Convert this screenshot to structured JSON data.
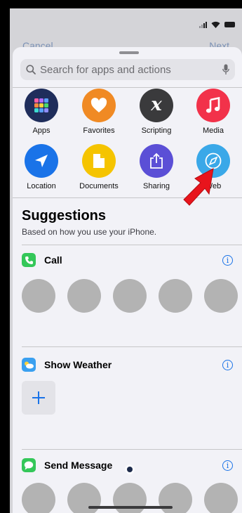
{
  "background": {
    "left_link": "Cancel",
    "right_link": "Next"
  },
  "search": {
    "placeholder": "Search for apps and actions"
  },
  "categories": [
    {
      "label": "Apps",
      "icon": "apps-grid-icon",
      "color": "#1f2d5b"
    },
    {
      "label": "Favorites",
      "icon": "heart-icon",
      "color": "#f08a24"
    },
    {
      "label": "Scripting",
      "icon": "scripting-x-icon",
      "color": "#3a3a3c"
    },
    {
      "label": "Media",
      "icon": "music-note-icon",
      "color": "#f2324a"
    },
    {
      "label": "Location",
      "icon": "location-arrow-icon",
      "color": "#1a73e8"
    },
    {
      "label": "Documents",
      "icon": "document-icon",
      "color": "#f5c400"
    },
    {
      "label": "Sharing",
      "icon": "share-icon",
      "color": "#5b4fd6"
    },
    {
      "label": "Web",
      "icon": "compass-icon",
      "color": "#3aa8e8"
    }
  ],
  "suggestions": {
    "title": "Suggestions",
    "subtitle": "Based on how you use your iPhone."
  },
  "sections": [
    {
      "name": "Call",
      "icon": "phone-icon",
      "color": "#34c759"
    },
    {
      "name": "Show Weather",
      "icon": "weather-icon",
      "color": "#3aa0f0"
    },
    {
      "name": "Send Message",
      "icon": "message-icon",
      "color": "#34c759"
    }
  ],
  "info_glyph": "i"
}
